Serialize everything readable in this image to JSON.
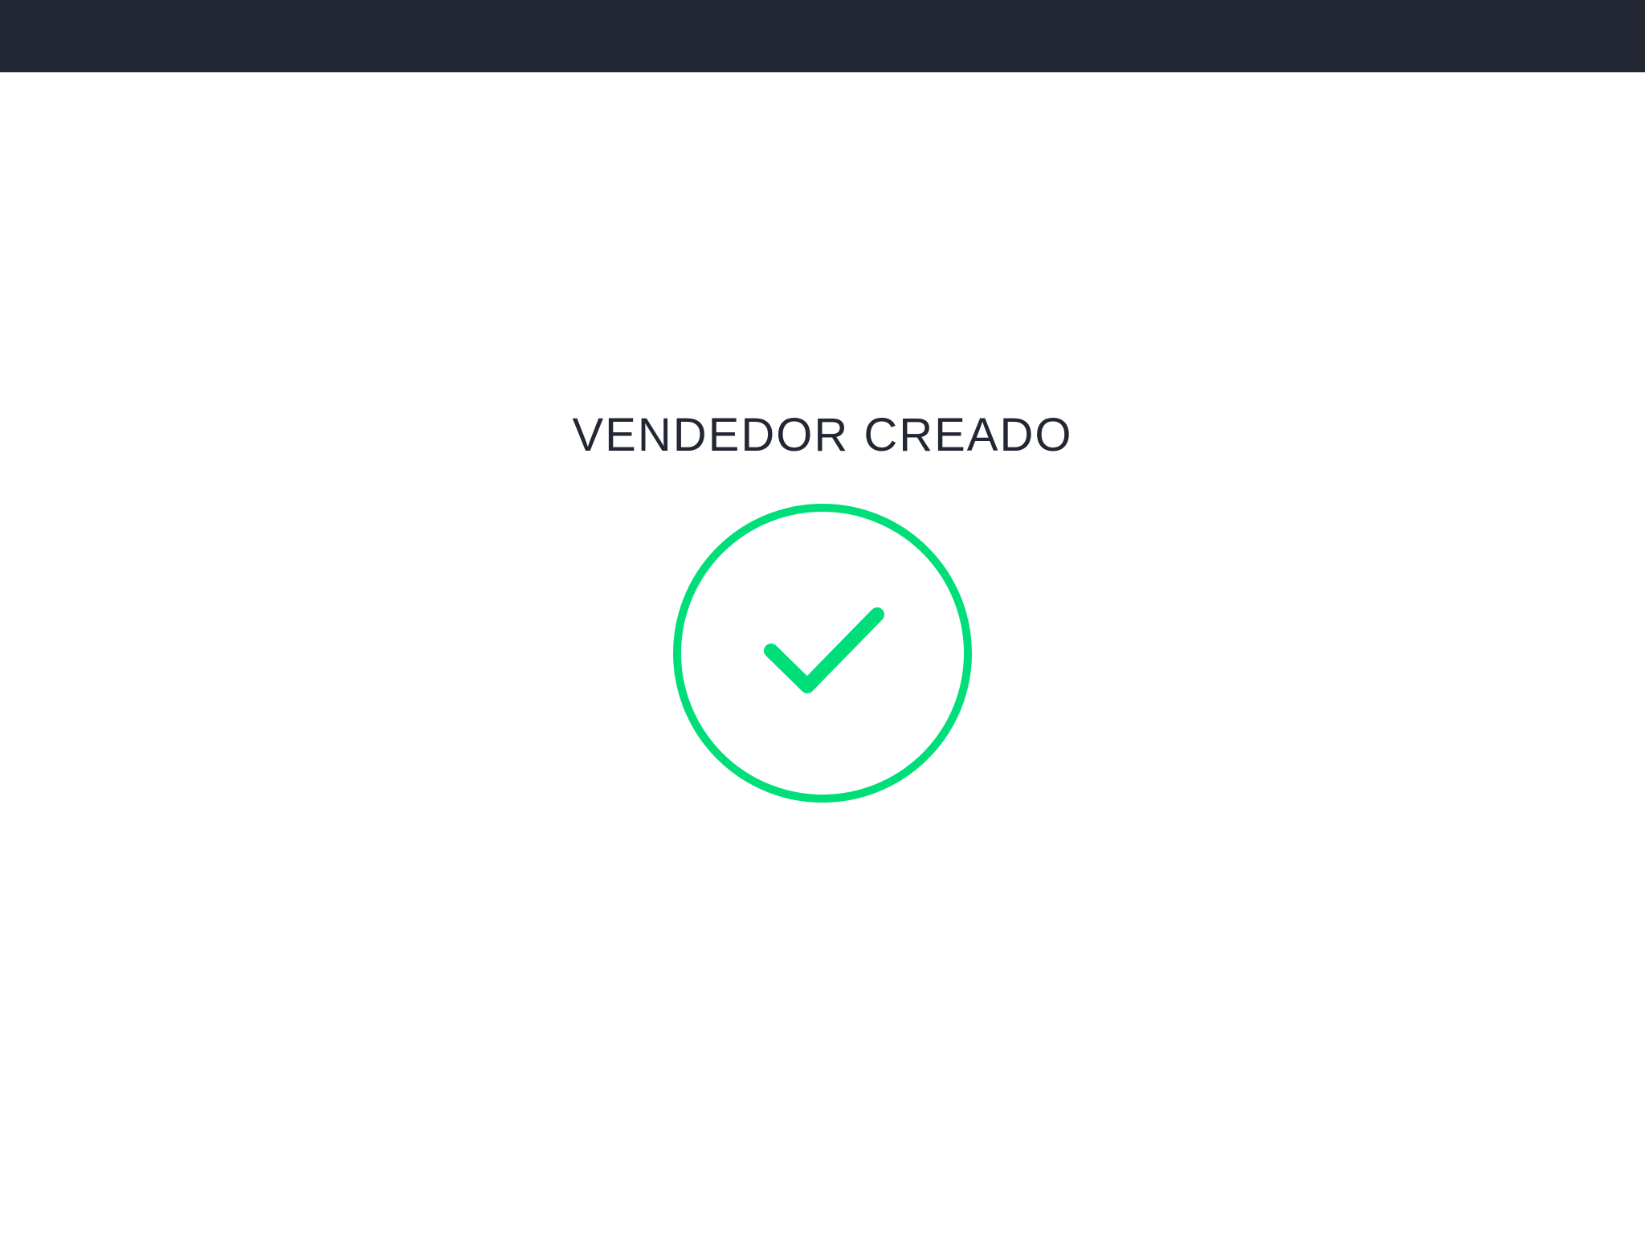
{
  "header": {
    "background_color": "#232734"
  },
  "success": {
    "title": "VENDEDOR CREADO",
    "icon": "check-circle-icon",
    "accent_color": "#00DE7A",
    "text_color": "#232734"
  }
}
